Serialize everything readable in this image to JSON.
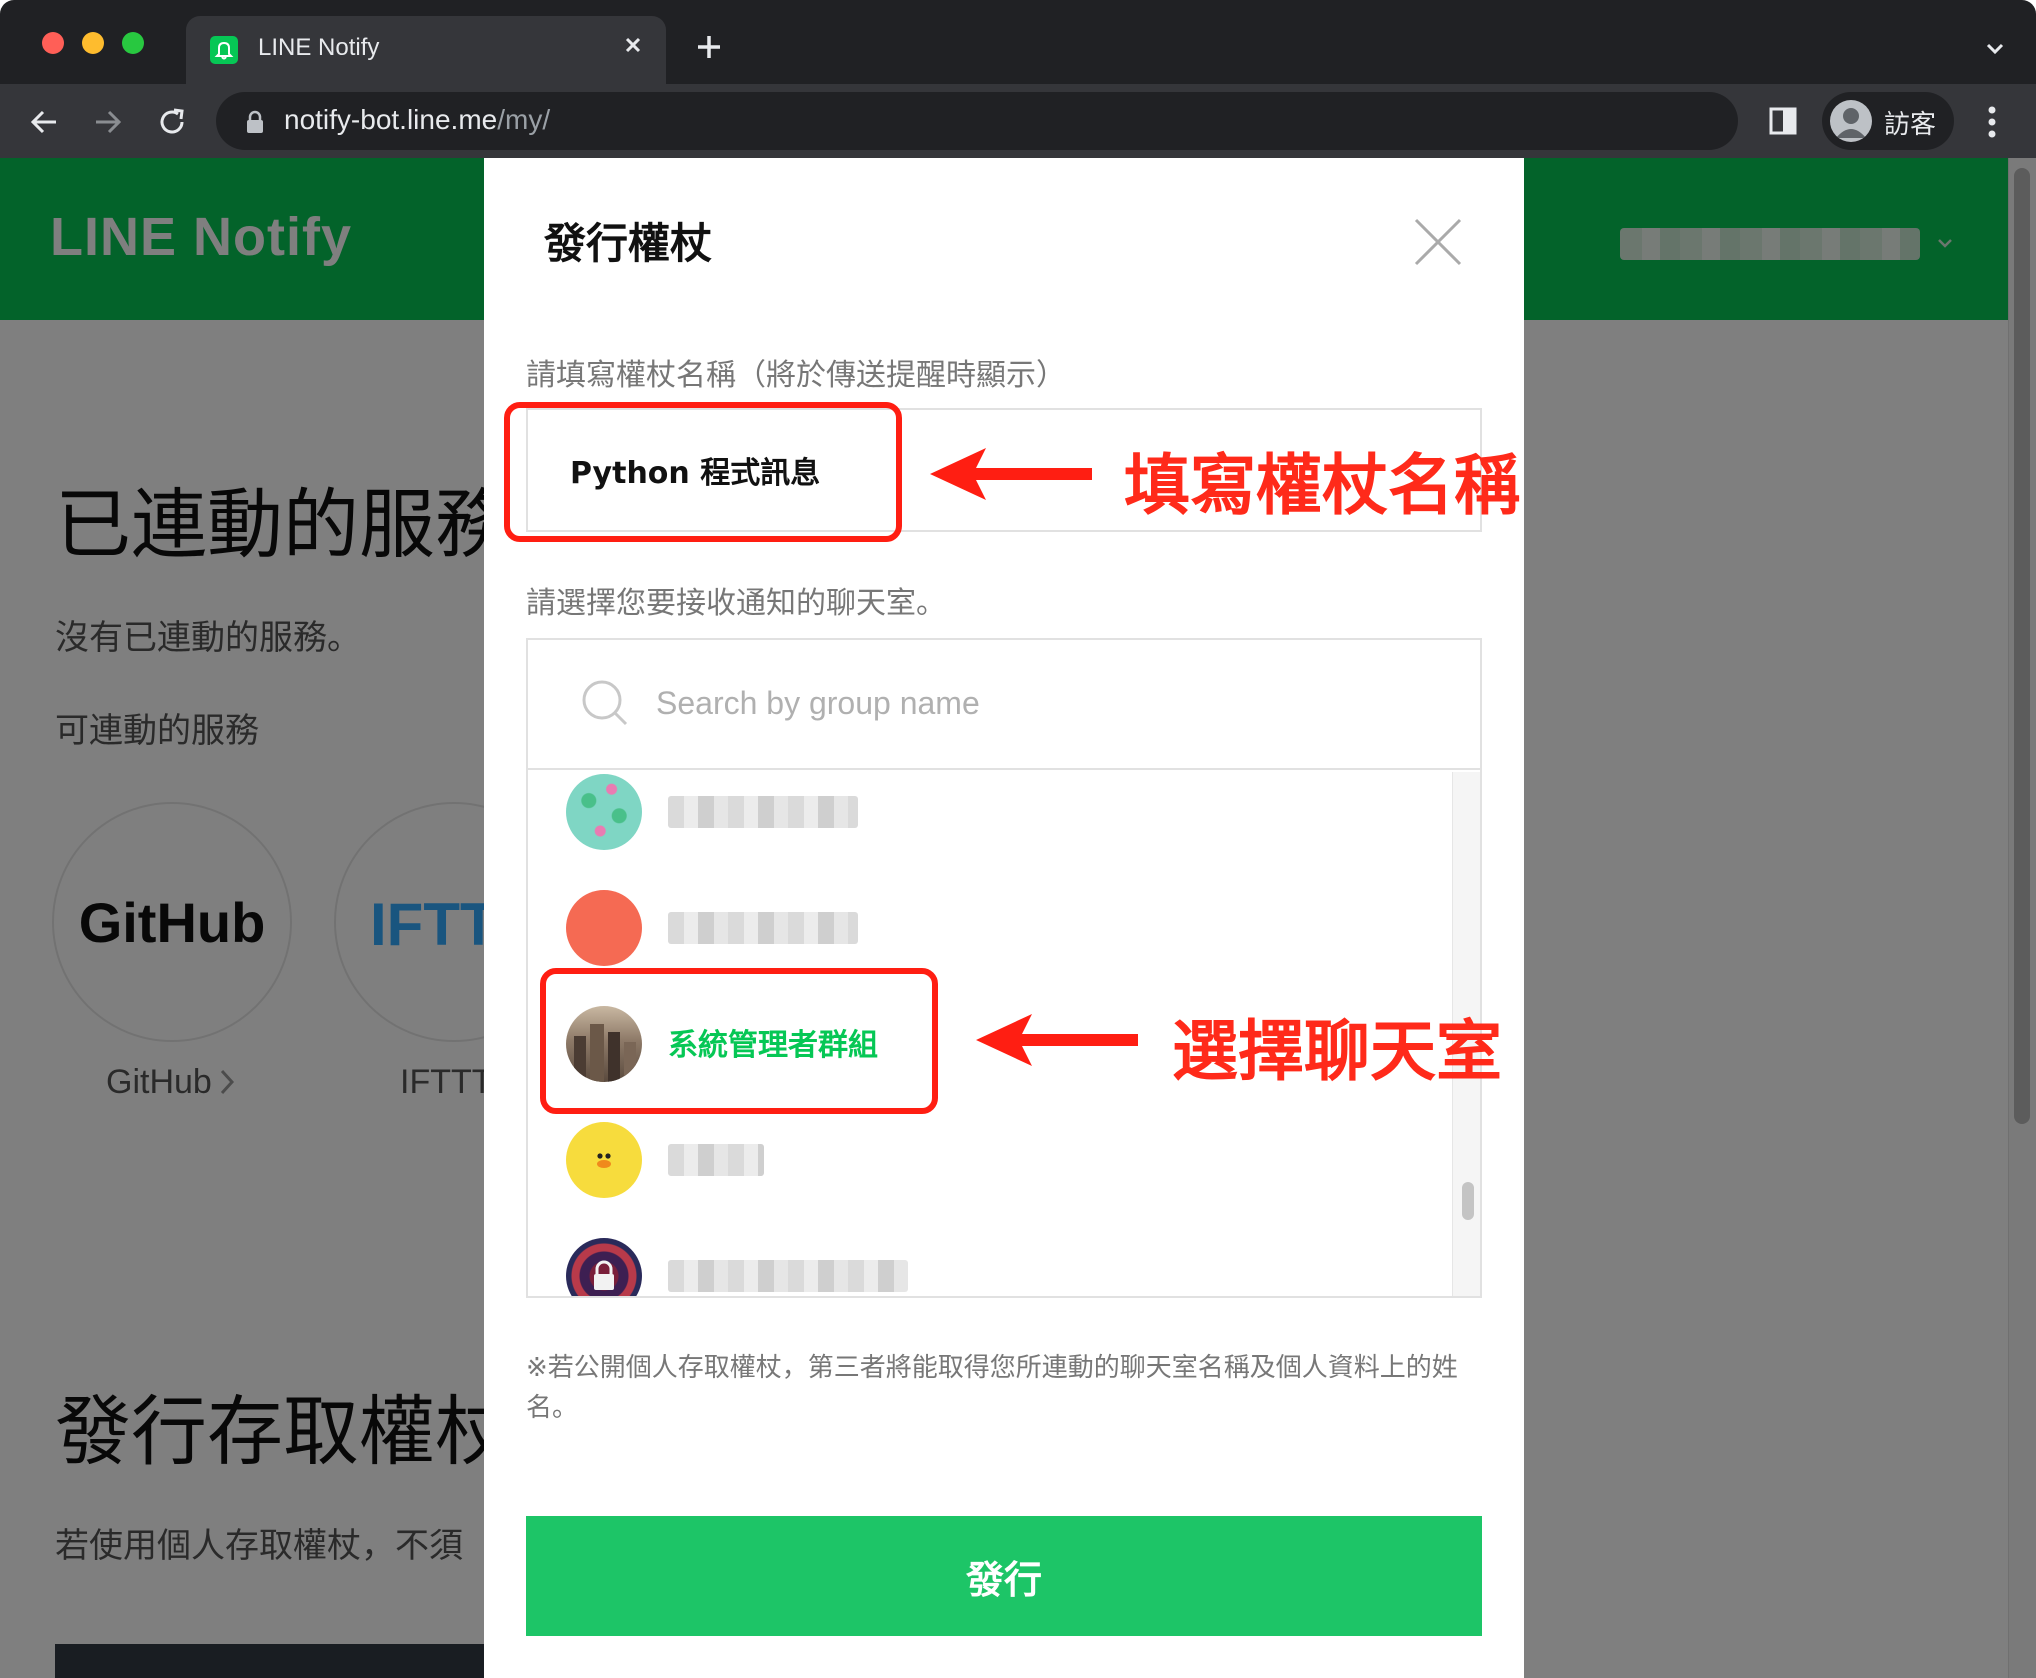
{
  "browser": {
    "tab_title": "LINE Notify",
    "url_host": "notify-bot.line.me",
    "url_path": "/my/",
    "profile_name": "訪客"
  },
  "site": {
    "logo": "LINE Notify",
    "brand_color": "#06c755"
  },
  "page": {
    "connected_heading": "已連動的服務",
    "no_services": "沒有已連動的服務。",
    "available_label": "可連動的服務",
    "services": [
      {
        "logo": "GitHub",
        "name": "GitHub"
      },
      {
        "logo": "IFTTT",
        "name": "IFTTT"
      }
    ],
    "issue_heading": "發行存取權杖",
    "issue_desc": "若使用個人存取權杖，不須"
  },
  "modal": {
    "title": "發行權杖",
    "name_label": "請填寫權杖名稱（將於傳送提醒時顯示）",
    "name_value": "Python 程式訊息",
    "chat_label": "請選擇您要接收通知的聊天室。",
    "search_placeholder": "Search by group name",
    "chats": [
      {
        "name": "",
        "avatar": "frog-pattern-avatar",
        "blurred": true
      },
      {
        "name": "",
        "avatar": "coral-circle-avatar",
        "blurred": true
      },
      {
        "name": "系統管理者群組",
        "avatar": "city-photo-avatar",
        "blurred": false,
        "selected": true
      },
      {
        "name": "",
        "avatar": "duck-avatar",
        "blurred": true
      },
      {
        "name": "",
        "avatar": "padlock-avatar",
        "blurred": true
      }
    ],
    "note": "※若公開個人存取權杖，第三者將能取得您所連動的聊天室名稱及個人資料上的姓名。",
    "submit_label": "發行",
    "submit_color": "#1dc567"
  },
  "annotations": {
    "fill_name": "填寫權杖名稱",
    "select_chat": "選擇聊天室",
    "color": "#ff1e12"
  }
}
